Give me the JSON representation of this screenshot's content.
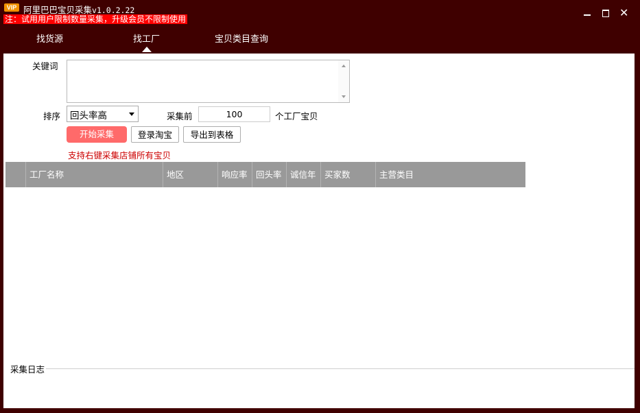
{
  "window": {
    "badge": "VIP",
    "title": "阿里巴巴宝贝采集",
    "version": "v1.0.2.22",
    "notice": "注：试用用户限制数量采集，升级会员不限制使用"
  },
  "nav": {
    "tabs": [
      {
        "label": "找货源",
        "active": false
      },
      {
        "label": "找工厂",
        "active": true
      },
      {
        "label": "宝贝类目查询",
        "active": false
      }
    ]
  },
  "form": {
    "keyword_label": "关键词",
    "keyword_value": "",
    "sort_label": "排序",
    "sort_selected": "回头率高",
    "collect_prefix": "采集前",
    "collect_count": "100",
    "collect_suffix": "个工厂宝贝"
  },
  "buttons": {
    "start": "开始采集",
    "login": "登录淘宝",
    "export": "导出到表格"
  },
  "hint": "支持右键采集店铺所有宝贝",
  "table": {
    "columns": [
      "",
      "工厂名称",
      "地区",
      "响应率",
      "回头率",
      "诚信年",
      "买家数",
      "主营类目"
    ],
    "rows": []
  },
  "log": {
    "label": "采集日志"
  },
  "colors": {
    "title_bg": "#3f0000",
    "notice_bg": "#ff0000",
    "primary_button": "#ff6a6a",
    "header_bg": "#999999",
    "hint_text": "#cc0000"
  }
}
